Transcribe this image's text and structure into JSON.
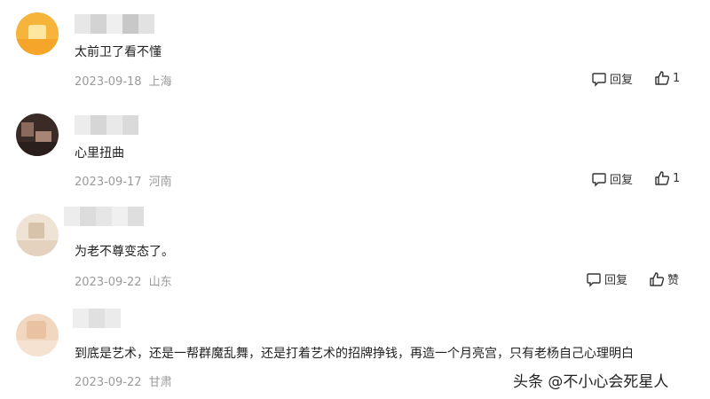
{
  "comments": [
    {
      "text": "太前卫了看不懂",
      "date": "2023-09-18",
      "location": "上海",
      "reply_label": "回复",
      "like_count": "1"
    },
    {
      "text": "心里扭曲",
      "date": "2023-09-17",
      "location": "河南",
      "reply_label": "回复",
      "like_count": "1"
    },
    {
      "text": "为老不尊变态了。",
      "date": "2023-09-22",
      "location": "山东",
      "reply_label": "回复",
      "like_count": "赞"
    },
    {
      "text": "到底是艺术，还是一帮群魔乱舞，还是打着艺术的招牌挣钱，再造一个月亮宫，只有老杨自己心理明白",
      "date": "2023-09-22",
      "location": "甘肃"
    }
  ],
  "watermark": "头条 @不小心会死星人",
  "colors": {
    "meta": "#9a9a9a",
    "text": "#222222"
  }
}
